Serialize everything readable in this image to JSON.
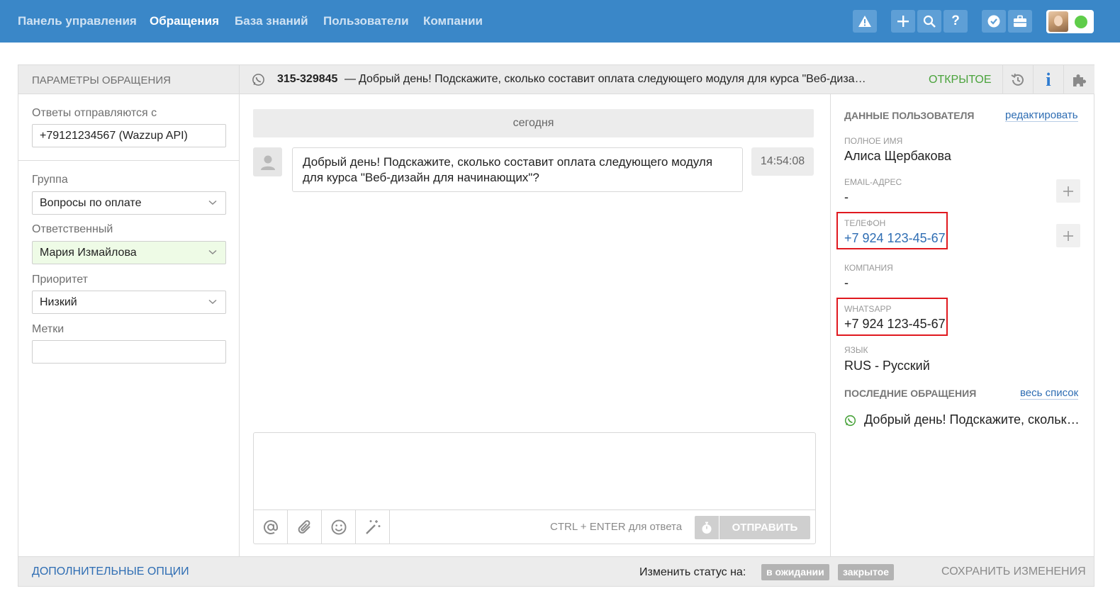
{
  "nav": {
    "items": [
      "Панель управления",
      "Обращения",
      "База знаний",
      "Пользователи",
      "Компании"
    ],
    "active_index": 1,
    "icons": [
      "warning-icon",
      "plus-icon",
      "search-icon",
      "help-icon",
      "shield-check-icon",
      "briefcase-icon"
    ],
    "online_color": "#5fcd4a",
    "brand_color": "#3a87c8"
  },
  "params": {
    "header": "ПАРАМЕТРЫ ОБРАЩЕНИЯ",
    "reply_from_label": "Ответы отправляются с",
    "reply_from_value": "+79121234567 (Wazzup API)",
    "group_label": "Группа",
    "group_value": "Вопросы по оплате",
    "assignee_label": "Ответственный",
    "assignee_value": "Мария Измайлова",
    "priority_label": "Приоритет",
    "priority_value": "Низкий",
    "tags_label": "Метки",
    "tags_value": ""
  },
  "ticket": {
    "number": "315-329845",
    "dash": "—",
    "subject": "Добрый день! Подскажите, сколько составит оплата следующего модуля для курса \"Веб-дизайн для начинающих\"?",
    "status": "ОТКРЫТОЕ",
    "status_color": "#4aa33c"
  },
  "chat": {
    "date_divider": "сегодня",
    "messages": [
      {
        "text": "Добрый день! Подскажите, сколько составит оплата следующего модуля для курса \"Веб-дизайн для начинающих\"?",
        "time": "14:54:08"
      }
    ]
  },
  "composer": {
    "hint": "CTRL + ENTER для ответа",
    "send_label": "ОТПРАВИТЬ",
    "tools": [
      "mention-icon",
      "attach-icon",
      "emoji-icon",
      "magic-wand-icon"
    ]
  },
  "user": {
    "section_title": "ДАННЫЕ ПОЛЬЗОВАТЕЛЯ",
    "edit_link": "редактировать",
    "fullname_label": "ПОЛНОЕ ИМЯ",
    "fullname": "Алиса Щербакова",
    "email_label": "EMAIL-АДРЕС",
    "email": "-",
    "phone_label": "ТЕЛЕФОН",
    "phone": "+7 924 123-45-67",
    "company_label": "КОМПАНИЯ",
    "company": "-",
    "whatsapp_label": "WHATSAPP",
    "whatsapp": "+7 924 123-45-67",
    "language_label": "ЯЗЫК",
    "language": "RUS - Русский",
    "highlight_color": "#e0191f"
  },
  "recent": {
    "title": "ПОСЛЕДНИЕ ОБРАЩЕНИЯ",
    "all_link": "весь список",
    "items": [
      "Добрый день! Подскажите, сколько составит оплата следующего модуля для курса \"Веб-дизайн для начинающих\"?"
    ]
  },
  "footer": {
    "more_options": "ДОПОЛНИТЕЛЬНЫЕ ОПЦИИ",
    "change_status_label": "Изменить статус на:",
    "status_pending": "в ожидании",
    "status_closed": "закрытое",
    "save": "СОХРАНИТЬ ИЗМЕНЕНИЯ"
  }
}
